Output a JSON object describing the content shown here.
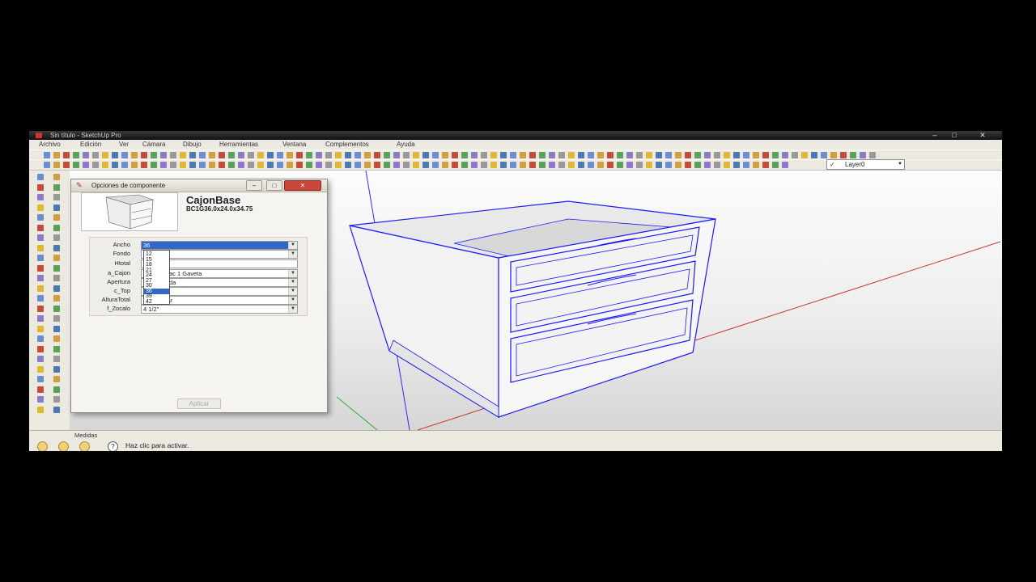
{
  "window": {
    "title": "Sin título - SketchUp Pro"
  },
  "menu": [
    "Archivo",
    "Edición",
    "Ver",
    "Cámara",
    "Dibujo",
    "Herramientas",
    "Ventana",
    "Complementos",
    "Ayuda"
  ],
  "layer": {
    "current": "Layer0"
  },
  "dialog": {
    "title": "Opciones de componente",
    "component_name": "CajonBase",
    "component_code": "BC1G36.0x24.0x34.75",
    "apply_label": "Aplicar",
    "fields": [
      {
        "label": "Ancho",
        "value": "36"
      },
      {
        "label": "Fondo",
        "value": ""
      },
      {
        "label": "Htotal",
        "value": ""
      },
      {
        "label": "a_Cajon",
        "value": "ac 1 Gaveta"
      },
      {
        "label": "Apertura",
        "value": "da"
      },
      {
        "label": "c_Top",
        "value": ""
      },
      {
        "label": "AlturaTotal",
        "value": "lar"
      },
      {
        "label": "f_Zocalo",
        "value": "4 1/2\""
      }
    ],
    "dropdown_options": [
      "12",
      "15",
      "18",
      "21",
      "24",
      "27",
      "30",
      "36",
      "39",
      "42"
    ],
    "dropdown_selected": "36"
  },
  "status": {
    "measures_label": "Medidas",
    "hint": "Haz clic para activar."
  },
  "colors": {
    "titlebar": "#1a1a1a",
    "chrome": "#ece9e1",
    "selection_edges": "#1a1aff",
    "axis_red": "#cc3333",
    "axis_green": "#33aa33"
  }
}
